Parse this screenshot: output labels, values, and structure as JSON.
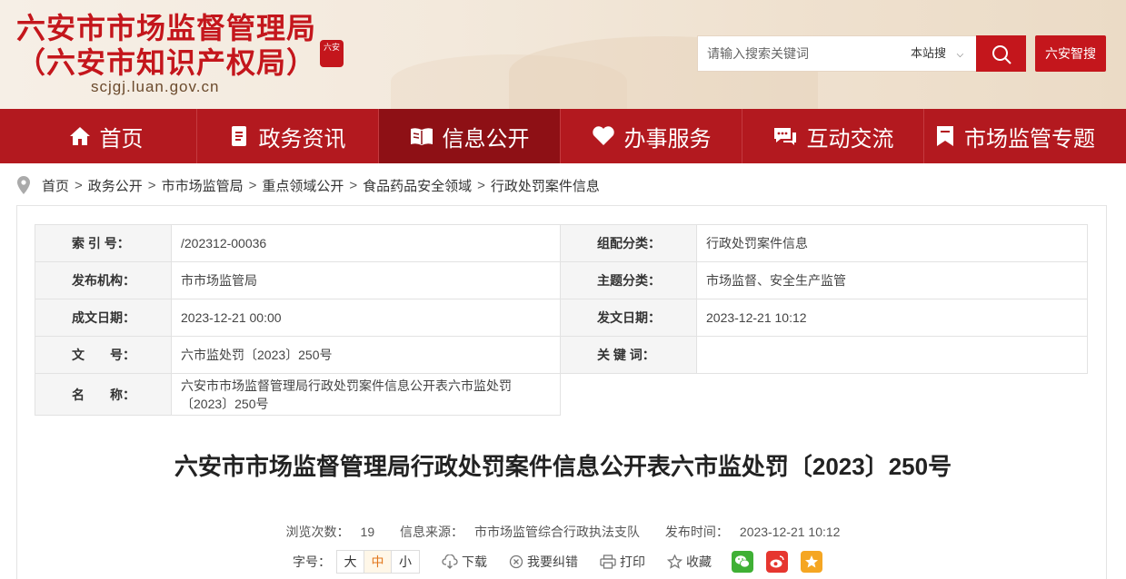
{
  "header": {
    "title_line1": "六安市市场监督管理局",
    "title_line2": "（六安市知识产权局）",
    "url": "scjgj.luan.gov.cn",
    "seal_text": "六安",
    "search_placeholder": "请输入搜索关键词",
    "search_scope": "本站搜",
    "smart_button": "六安智搜",
    "brand_color": "#c4161c"
  },
  "nav": {
    "items": [
      {
        "label": "首页",
        "icon": "home-icon"
      },
      {
        "label": "政务资讯",
        "icon": "document-icon"
      },
      {
        "label": "信息公开",
        "icon": "open-book-icon",
        "active": true
      },
      {
        "label": "办事服务",
        "icon": "heart-icon"
      },
      {
        "label": "互动交流",
        "icon": "chat-icon"
      },
      {
        "label": "市场监管专题",
        "icon": "bookmark-icon"
      }
    ],
    "bg_color": "#b3191f",
    "active_color": "#8e1015"
  },
  "breadcrumb": [
    "首页",
    "政务公开",
    "市市场监管局",
    "重点领域公开",
    "食品药品安全领域",
    "行政处罚案件信息"
  ],
  "meta": {
    "index_label": "索 引 号：",
    "index_value": "/202312-00036",
    "category_label": "组配分类：",
    "category_value": "行政处罚案件信息",
    "publisher_label": "发布机构：",
    "publisher_value": "市市场监管局",
    "topic_label": "主题分类：",
    "topic_value": "市场监督、安全生产监管",
    "created_label": "成文日期：",
    "created_value": "2023-12-21 00:00",
    "issued_label": "发文日期：",
    "issued_value": "2023-12-21 10:12",
    "doc_no_label": "文　　号：",
    "doc_no_value": "六市监处罚〔2023〕250号",
    "keywords_label": "关 键 词：",
    "keywords_value": "",
    "name_label": "名　　称：",
    "name_value": "六安市市场监督管理局行政处罚案件信息公开表六市监处罚〔2023〕250号"
  },
  "article": {
    "title": "六安市市场监督管理局行政处罚案件信息公开表六市监处罚〔2023〕250号",
    "views_label": "浏览次数：",
    "views_value": "19",
    "source_label": "信息来源：",
    "source_value": "市市场监管综合行政执法支队",
    "time_label": "发布时间：",
    "time_value": "2023-12-21 10:12"
  },
  "tools": {
    "font_size_label": "字号：",
    "sizes": [
      "大",
      "中",
      "小"
    ],
    "download": "下载",
    "report_error": "我要纠错",
    "print": "打印",
    "favorite": "收藏"
  }
}
